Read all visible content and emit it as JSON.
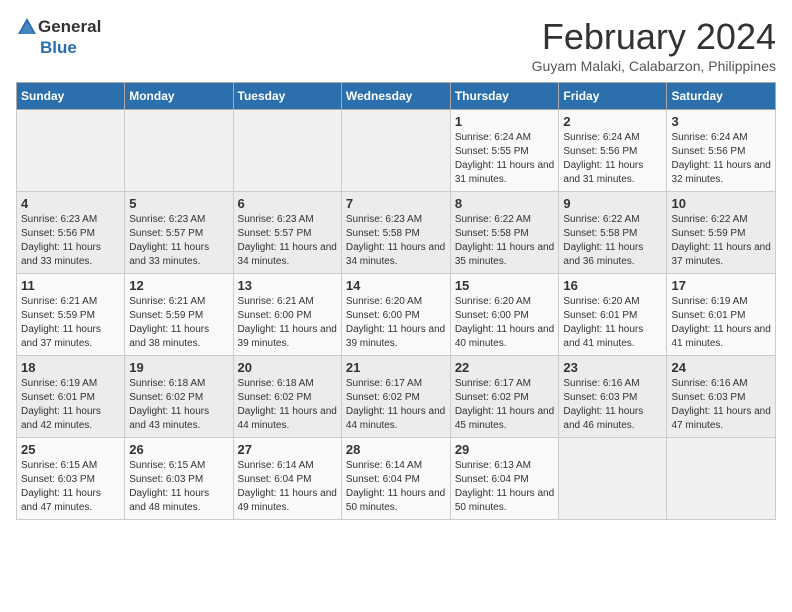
{
  "logo": {
    "general": "General",
    "blue": "Blue"
  },
  "title": "February 2024",
  "location": "Guyam Malaki, Calabarzon, Philippines",
  "days_of_week": [
    "Sunday",
    "Monday",
    "Tuesday",
    "Wednesday",
    "Thursday",
    "Friday",
    "Saturday"
  ],
  "weeks": [
    [
      {
        "day": "",
        "sunrise": "",
        "sunset": "",
        "daylight": ""
      },
      {
        "day": "",
        "sunrise": "",
        "sunset": "",
        "daylight": ""
      },
      {
        "day": "",
        "sunrise": "",
        "sunset": "",
        "daylight": ""
      },
      {
        "day": "",
        "sunrise": "",
        "sunset": "",
        "daylight": ""
      },
      {
        "day": "1",
        "sunrise": "Sunrise: 6:24 AM",
        "sunset": "Sunset: 5:55 PM",
        "daylight": "Daylight: 11 hours and 31 minutes."
      },
      {
        "day": "2",
        "sunrise": "Sunrise: 6:24 AM",
        "sunset": "Sunset: 5:56 PM",
        "daylight": "Daylight: 11 hours and 31 minutes."
      },
      {
        "day": "3",
        "sunrise": "Sunrise: 6:24 AM",
        "sunset": "Sunset: 5:56 PM",
        "daylight": "Daylight: 11 hours and 32 minutes."
      }
    ],
    [
      {
        "day": "4",
        "sunrise": "Sunrise: 6:23 AM",
        "sunset": "Sunset: 5:56 PM",
        "daylight": "Daylight: 11 hours and 33 minutes."
      },
      {
        "day": "5",
        "sunrise": "Sunrise: 6:23 AM",
        "sunset": "Sunset: 5:57 PM",
        "daylight": "Daylight: 11 hours and 33 minutes."
      },
      {
        "day": "6",
        "sunrise": "Sunrise: 6:23 AM",
        "sunset": "Sunset: 5:57 PM",
        "daylight": "Daylight: 11 hours and 34 minutes."
      },
      {
        "day": "7",
        "sunrise": "Sunrise: 6:23 AM",
        "sunset": "Sunset: 5:58 PM",
        "daylight": "Daylight: 11 hours and 34 minutes."
      },
      {
        "day": "8",
        "sunrise": "Sunrise: 6:22 AM",
        "sunset": "Sunset: 5:58 PM",
        "daylight": "Daylight: 11 hours and 35 minutes."
      },
      {
        "day": "9",
        "sunrise": "Sunrise: 6:22 AM",
        "sunset": "Sunset: 5:58 PM",
        "daylight": "Daylight: 11 hours and 36 minutes."
      },
      {
        "day": "10",
        "sunrise": "Sunrise: 6:22 AM",
        "sunset": "Sunset: 5:59 PM",
        "daylight": "Daylight: 11 hours and 37 minutes."
      }
    ],
    [
      {
        "day": "11",
        "sunrise": "Sunrise: 6:21 AM",
        "sunset": "Sunset: 5:59 PM",
        "daylight": "Daylight: 11 hours and 37 minutes."
      },
      {
        "day": "12",
        "sunrise": "Sunrise: 6:21 AM",
        "sunset": "Sunset: 5:59 PM",
        "daylight": "Daylight: 11 hours and 38 minutes."
      },
      {
        "day": "13",
        "sunrise": "Sunrise: 6:21 AM",
        "sunset": "Sunset: 6:00 PM",
        "daylight": "Daylight: 11 hours and 39 minutes."
      },
      {
        "day": "14",
        "sunrise": "Sunrise: 6:20 AM",
        "sunset": "Sunset: 6:00 PM",
        "daylight": "Daylight: 11 hours and 39 minutes."
      },
      {
        "day": "15",
        "sunrise": "Sunrise: 6:20 AM",
        "sunset": "Sunset: 6:00 PM",
        "daylight": "Daylight: 11 hours and 40 minutes."
      },
      {
        "day": "16",
        "sunrise": "Sunrise: 6:20 AM",
        "sunset": "Sunset: 6:01 PM",
        "daylight": "Daylight: 11 hours and 41 minutes."
      },
      {
        "day": "17",
        "sunrise": "Sunrise: 6:19 AM",
        "sunset": "Sunset: 6:01 PM",
        "daylight": "Daylight: 11 hours and 41 minutes."
      }
    ],
    [
      {
        "day": "18",
        "sunrise": "Sunrise: 6:19 AM",
        "sunset": "Sunset: 6:01 PM",
        "daylight": "Daylight: 11 hours and 42 minutes."
      },
      {
        "day": "19",
        "sunrise": "Sunrise: 6:18 AM",
        "sunset": "Sunset: 6:02 PM",
        "daylight": "Daylight: 11 hours and 43 minutes."
      },
      {
        "day": "20",
        "sunrise": "Sunrise: 6:18 AM",
        "sunset": "Sunset: 6:02 PM",
        "daylight": "Daylight: 11 hours and 44 minutes."
      },
      {
        "day": "21",
        "sunrise": "Sunrise: 6:17 AM",
        "sunset": "Sunset: 6:02 PM",
        "daylight": "Daylight: 11 hours and 44 minutes."
      },
      {
        "day": "22",
        "sunrise": "Sunrise: 6:17 AM",
        "sunset": "Sunset: 6:02 PM",
        "daylight": "Daylight: 11 hours and 45 minutes."
      },
      {
        "day": "23",
        "sunrise": "Sunrise: 6:16 AM",
        "sunset": "Sunset: 6:03 PM",
        "daylight": "Daylight: 11 hours and 46 minutes."
      },
      {
        "day": "24",
        "sunrise": "Sunrise: 6:16 AM",
        "sunset": "Sunset: 6:03 PM",
        "daylight": "Daylight: 11 hours and 47 minutes."
      }
    ],
    [
      {
        "day": "25",
        "sunrise": "Sunrise: 6:15 AM",
        "sunset": "Sunset: 6:03 PM",
        "daylight": "Daylight: 11 hours and 47 minutes."
      },
      {
        "day": "26",
        "sunrise": "Sunrise: 6:15 AM",
        "sunset": "Sunset: 6:03 PM",
        "daylight": "Daylight: 11 hours and 48 minutes."
      },
      {
        "day": "27",
        "sunrise": "Sunrise: 6:14 AM",
        "sunset": "Sunset: 6:04 PM",
        "daylight": "Daylight: 11 hours and 49 minutes."
      },
      {
        "day": "28",
        "sunrise": "Sunrise: 6:14 AM",
        "sunset": "Sunset: 6:04 PM",
        "daylight": "Daylight: 11 hours and 50 minutes."
      },
      {
        "day": "29",
        "sunrise": "Sunrise: 6:13 AM",
        "sunset": "Sunset: 6:04 PM",
        "daylight": "Daylight: 11 hours and 50 minutes."
      },
      {
        "day": "",
        "sunrise": "",
        "sunset": "",
        "daylight": ""
      },
      {
        "day": "",
        "sunrise": "",
        "sunset": "",
        "daylight": ""
      }
    ]
  ]
}
